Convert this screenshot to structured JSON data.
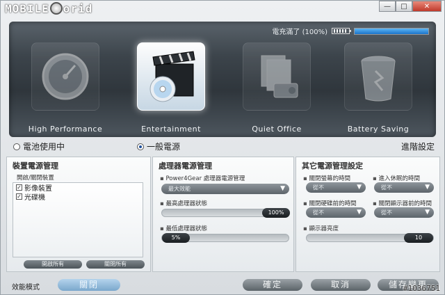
{
  "app": {
    "logo_text_left": "MOBILE",
    "logo_text_right": "orid"
  },
  "window_buttons": {
    "minimize": "—",
    "maximize": "□",
    "close": "✕"
  },
  "battery": {
    "status_text": "電充滿了 (100%)",
    "level": 1.0
  },
  "modes": [
    {
      "label": "High Performance",
      "icon": "speedometer-icon"
    },
    {
      "label": "Entertainment",
      "icon": "clapperboard-dvd-icon"
    },
    {
      "label": "Quiet Office",
      "icon": "office-documents-projector-icon"
    },
    {
      "label": "Battery Saving",
      "icon": "trash-bin-icon"
    }
  ],
  "power_source": {
    "battery_label": "電池使用中",
    "ac_label": "一般電源",
    "advanced_label": "進階設定"
  },
  "device_panel": {
    "title": "裝置電源管理",
    "subtitle": "開啟/關閉裝置",
    "items": [
      {
        "label": "影像裝置",
        "checked": true
      },
      {
        "label": "光碟機",
        "checked": true
      }
    ],
    "open_all": "開啟所有",
    "close_all": "關閉所有"
  },
  "cpu_panel": {
    "title": "處理器電源管理",
    "p4g_label": "Power4Gear 處理器電源管理",
    "p4g_value": "最大效能",
    "max_label": "最高處理器狀態",
    "max_value": "100%",
    "max_level": 1.0,
    "min_label": "最低處理器狀態",
    "min_value": "5%",
    "min_level": 0.05
  },
  "other_panel": {
    "title": "其它電源管理設定",
    "monitor_off_label": "關閉螢幕的時間",
    "monitor_off_value": "從不",
    "sleep_label": "進入休眠的時間",
    "sleep_value": "從不",
    "disk_off_label": "關閉硬碟前的時間",
    "disk_off_value": "從不",
    "display_off_label": "關閉顯示器前的時間",
    "display_off_value": "從不",
    "brightness_label": "顯示器亮度",
    "brightness_value": "10"
  },
  "bottom": {
    "mode_label": "效能模式",
    "toggle_label": "關閉",
    "ok_label": "確定",
    "cancel_label": "取消",
    "save_label": "儲存變更",
    "watermark": "#1036751"
  },
  "colors": {
    "accent_blue": "#1b73c8",
    "active_tile": "#c7d7e4",
    "stage_dark": "#2f363c"
  }
}
